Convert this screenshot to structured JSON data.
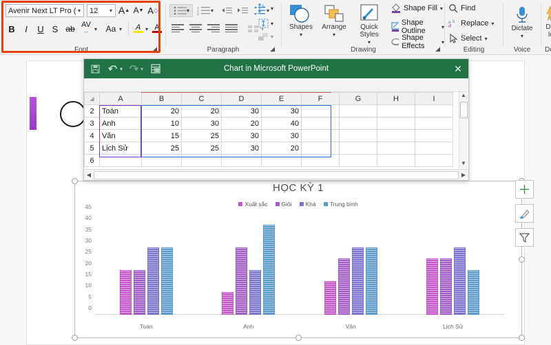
{
  "ribbon": {
    "font_group": {
      "label": "Font",
      "font_name": "Avenir Next LT Pro (Bod",
      "font_size": "12",
      "grow_font": "A",
      "shrink_font": "A",
      "clear_formatting": "A",
      "bold": "B",
      "italic": "I",
      "underline": "U",
      "strikethrough": "S",
      "text_shadow": "ab",
      "character_spacing": "AV",
      "change_case": "Aa",
      "text_highlight": "A",
      "font_color": "A",
      "dialog_launcher": "◢"
    },
    "paragraph_group": {
      "label": "Paragraph",
      "dialog_launcher": "◢"
    },
    "drawing_group": {
      "label": "Drawing",
      "shapes": "Shapes",
      "arrange": "Arrange",
      "quick_styles": "Quick\nStyles",
      "shape_fill": "Shape Fill",
      "shape_outline": "Shape Outline",
      "shape_effects": "Shape Effects",
      "dialog_launcher": "◢"
    },
    "editing_group": {
      "label": "Editing",
      "find": "Find",
      "replace": "Replace",
      "select": "Select"
    },
    "voice_group": {
      "label": "Voice",
      "dictate": "Dictate"
    },
    "designer_group": {
      "label": "Designer",
      "design_ideas": "Design\nIdeas"
    }
  },
  "excel_window": {
    "title": "Chart in Microsoft PowerPoint",
    "close_label": "✕",
    "icons": {
      "save": "save-icon",
      "undo": "undo-icon",
      "redo": "redo-icon",
      "edit_data": "edit-data-icon"
    },
    "column_headers": [
      "A",
      "B",
      "C",
      "D",
      "E",
      "F",
      "G",
      "H",
      "I"
    ],
    "row_numbers": [
      "2",
      "3",
      "4",
      "5",
      "6"
    ],
    "rows": [
      {
        "num": "2",
        "cells": [
          "Toán",
          "20",
          "20",
          "30",
          "30",
          "",
          "",
          "",
          ""
        ]
      },
      {
        "num": "3",
        "cells": [
          "Anh",
          "10",
          "30",
          "20",
          "40",
          "",
          "",
          "",
          ""
        ]
      },
      {
        "num": "4",
        "cells": [
          "Văn",
          "15",
          "25",
          "30",
          "30",
          "",
          "",
          "",
          ""
        ]
      },
      {
        "num": "5",
        "cells": [
          "Lịch Sử",
          "25",
          "25",
          "30",
          "20",
          "",
          "",
          "",
          ""
        ]
      },
      {
        "num": "6",
        "cells": [
          "",
          "",
          "",
          "",
          "",
          "",
          "",
          "",
          ""
        ]
      }
    ]
  },
  "chart_data": {
    "type": "bar",
    "title": "HỌC KỲ 1",
    "xlabel": "",
    "ylabel": "",
    "ylim": [
      0,
      45
    ],
    "yticks": [
      45,
      40,
      35,
      30,
      25,
      20,
      15,
      10,
      5,
      0
    ],
    "grid": false,
    "legend_position": "top",
    "categories": [
      "Toán",
      "Anh",
      "Văn",
      "Lịch Sử"
    ],
    "series": [
      {
        "name": "Xuất sắc",
        "color": "#c455c8",
        "values": [
          20,
          10,
          15,
          25
        ]
      },
      {
        "name": "Giỏi",
        "color": "#a05cc4",
        "values": [
          20,
          30,
          25,
          25
        ]
      },
      {
        "name": "Khá",
        "color": "#7b74cf",
        "values": [
          30,
          20,
          30,
          30
        ]
      },
      {
        "name": "Trung bình",
        "color": "#5b9bcb",
        "values": [
          30,
          40,
          30,
          20
        ]
      }
    ]
  },
  "chart_side_buttons": [
    {
      "name": "chart-elements",
      "glyph": "+"
    },
    {
      "name": "chart-styles",
      "glyph": "brush"
    },
    {
      "name": "chart-filters",
      "glyph": "funnel"
    }
  ],
  "colors": {
    "excel_green": "#217346",
    "highlight_red": "#e8400a",
    "ribbon_bg": "#f3f2f1"
  }
}
